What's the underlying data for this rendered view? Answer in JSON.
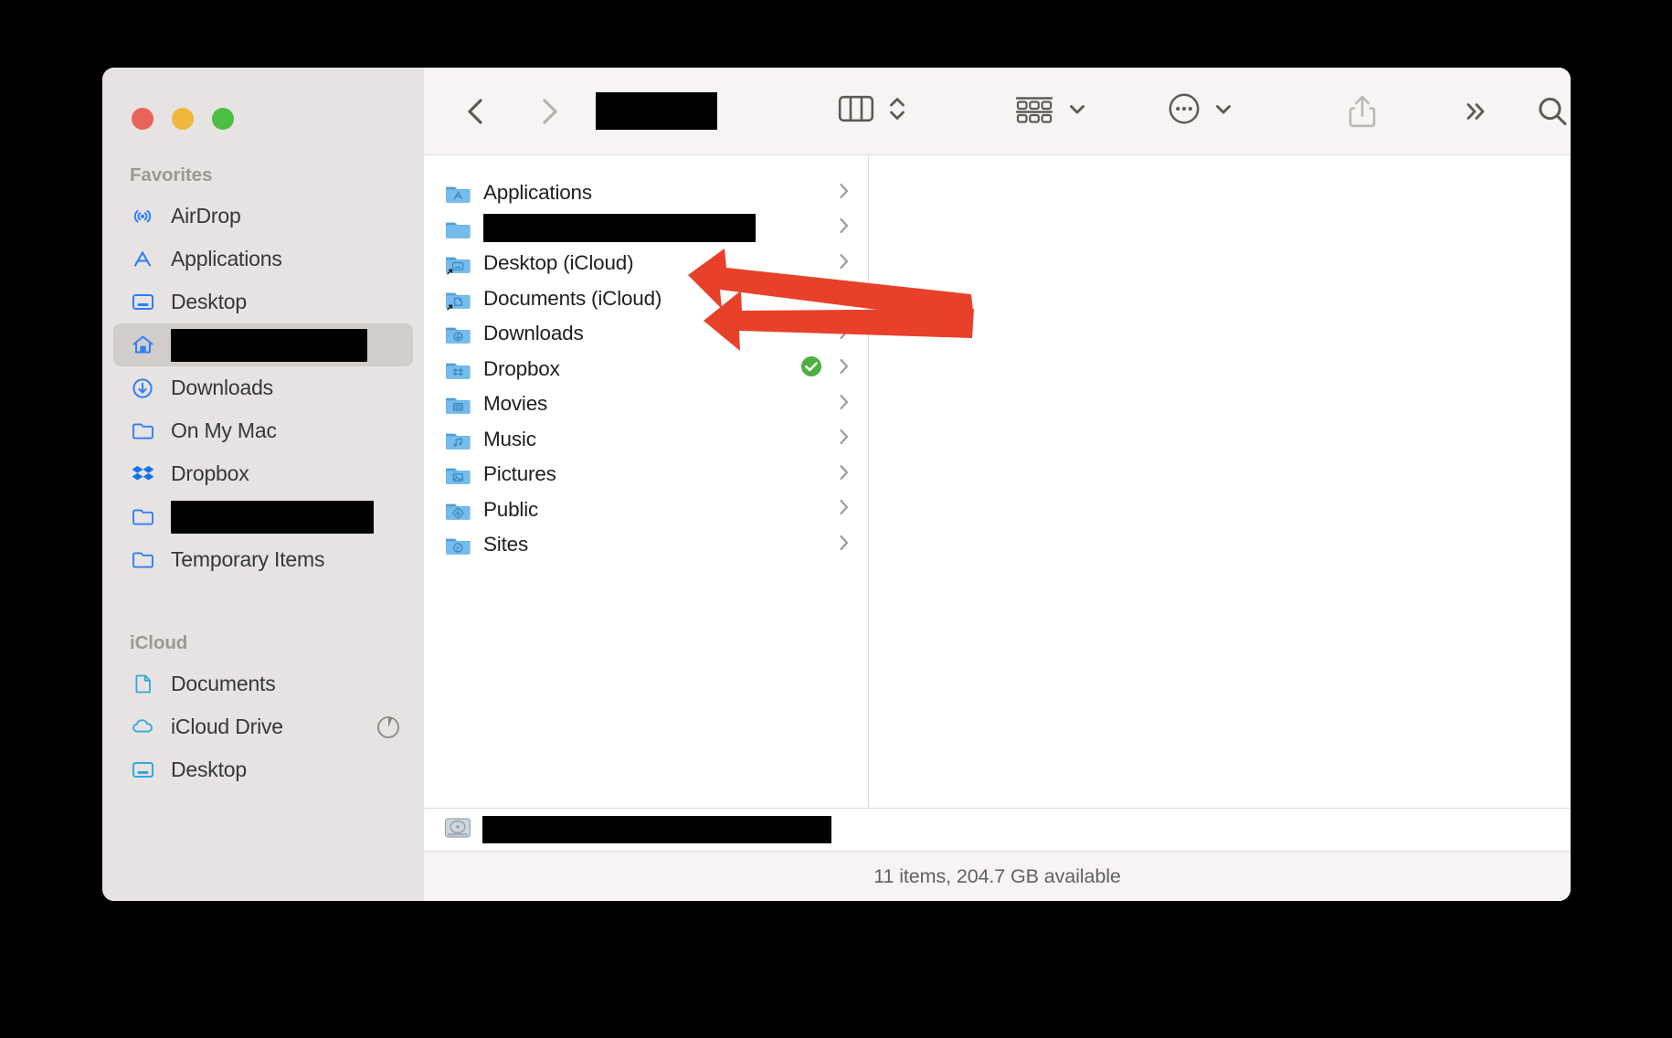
{
  "window": {
    "traffic_lights": [
      {
        "name": "close",
        "color": "#E8635A"
      },
      {
        "name": "minimize",
        "color": "#F0B73D"
      },
      {
        "name": "zoom",
        "color": "#4CBF43"
      }
    ]
  },
  "toolbar": {
    "back_label": "Back",
    "forward_label": "Forward",
    "title_redacted": true,
    "view_mode": "column",
    "view_label": "Column View",
    "view_switch_label": "Change item arrangement",
    "group_label": "Group items",
    "more_label": "More actions",
    "share_label": "Share",
    "overflow_label": "More toolbar items",
    "search_label": "Search"
  },
  "sidebar": {
    "sections": [
      {
        "title": "Favorites",
        "items": [
          {
            "label": "AirDrop",
            "icon": "airdrop-icon",
            "redacted": false,
            "selected": false
          },
          {
            "label": "Applications",
            "icon": "applications-icon",
            "redacted": false,
            "selected": false
          },
          {
            "label": "Desktop",
            "icon": "desktop-icon",
            "redacted": false,
            "selected": false
          },
          {
            "label": "",
            "icon": "home-icon",
            "redacted": true,
            "redact_width": 215,
            "selected": true
          },
          {
            "label": "Downloads",
            "icon": "downloads-icon",
            "redacted": false,
            "selected": false
          },
          {
            "label": "On My Mac",
            "icon": "folder-icon",
            "redacted": false,
            "selected": false
          },
          {
            "label": "Dropbox",
            "icon": "dropbox-icon",
            "redacted": false,
            "selected": false
          },
          {
            "label": "",
            "icon": "folder-icon",
            "redacted": true,
            "redact_width": 222,
            "selected": false
          },
          {
            "label": "Temporary Items",
            "icon": "folder-icon",
            "redacted": false,
            "selected": false
          }
        ]
      },
      {
        "title": "iCloud",
        "items": [
          {
            "label": "Documents",
            "icon": "document-icon",
            "redacted": false,
            "selected": false
          },
          {
            "label": "iCloud Drive",
            "icon": "cloud-icon",
            "redacted": false,
            "selected": false,
            "badge": "sync-progress-icon"
          },
          {
            "label": "Desktop",
            "icon": "desktop-icon",
            "redacted": false,
            "selected": false
          }
        ]
      }
    ]
  },
  "file_list": {
    "items": [
      {
        "name": "Applications",
        "icon": "folder-applications-icon",
        "redacted": false,
        "alias": false,
        "status": null,
        "chevron": true
      },
      {
        "name": "",
        "icon": "folder-plain-icon",
        "redacted": true,
        "alias": false,
        "status": null,
        "chevron": true
      },
      {
        "name": "Desktop (iCloud)",
        "icon": "folder-desktop-icon",
        "redacted": false,
        "alias": true,
        "status": null,
        "chevron": true
      },
      {
        "name": "Documents (iCloud)",
        "icon": "folder-documents-icon",
        "redacted": false,
        "alias": true,
        "status": null,
        "chevron": true
      },
      {
        "name": "Downloads",
        "icon": "folder-downloads-icon",
        "redacted": false,
        "alias": false,
        "status": null,
        "chevron": true
      },
      {
        "name": "Dropbox",
        "icon": "folder-dropbox-icon",
        "redacted": false,
        "alias": false,
        "status": "synced-check-icon",
        "chevron": true
      },
      {
        "name": "Movies",
        "icon": "folder-movies-icon",
        "redacted": false,
        "alias": false,
        "status": null,
        "chevron": true
      },
      {
        "name": "Music",
        "icon": "folder-music-icon",
        "redacted": false,
        "alias": false,
        "status": null,
        "chevron": true
      },
      {
        "name": "Pictures",
        "icon": "folder-pictures-icon",
        "redacted": false,
        "alias": false,
        "status": null,
        "chevron": true
      },
      {
        "name": "Public",
        "icon": "folder-public-icon",
        "redacted": false,
        "alias": false,
        "status": null,
        "chevron": true
      },
      {
        "name": "Sites",
        "icon": "folder-sites-icon",
        "redacted": false,
        "alias": false,
        "status": null,
        "chevron": true
      }
    ]
  },
  "path_bar": {
    "icon": "hard-drive-icon",
    "path_redacted": true
  },
  "status_bar": {
    "text": "11 items, 204.7 GB available"
  },
  "annotations": {
    "arrow_color": "#E8412A",
    "arrows": [
      {
        "label": "arrow-to-desktop-icloud",
        "points_to": "Desktop (iCloud)"
      },
      {
        "label": "arrow-to-documents-icloud",
        "points_to": "Documents (iCloud)"
      }
    ]
  },
  "colors": {
    "sidebar_bg": "#E7E3E2",
    "toolbar_bg": "#F7F4F3",
    "accent_blue": "#2D7FF9",
    "folder_blue": "#6FB8E8",
    "sync_green": "#4CAF3F"
  }
}
